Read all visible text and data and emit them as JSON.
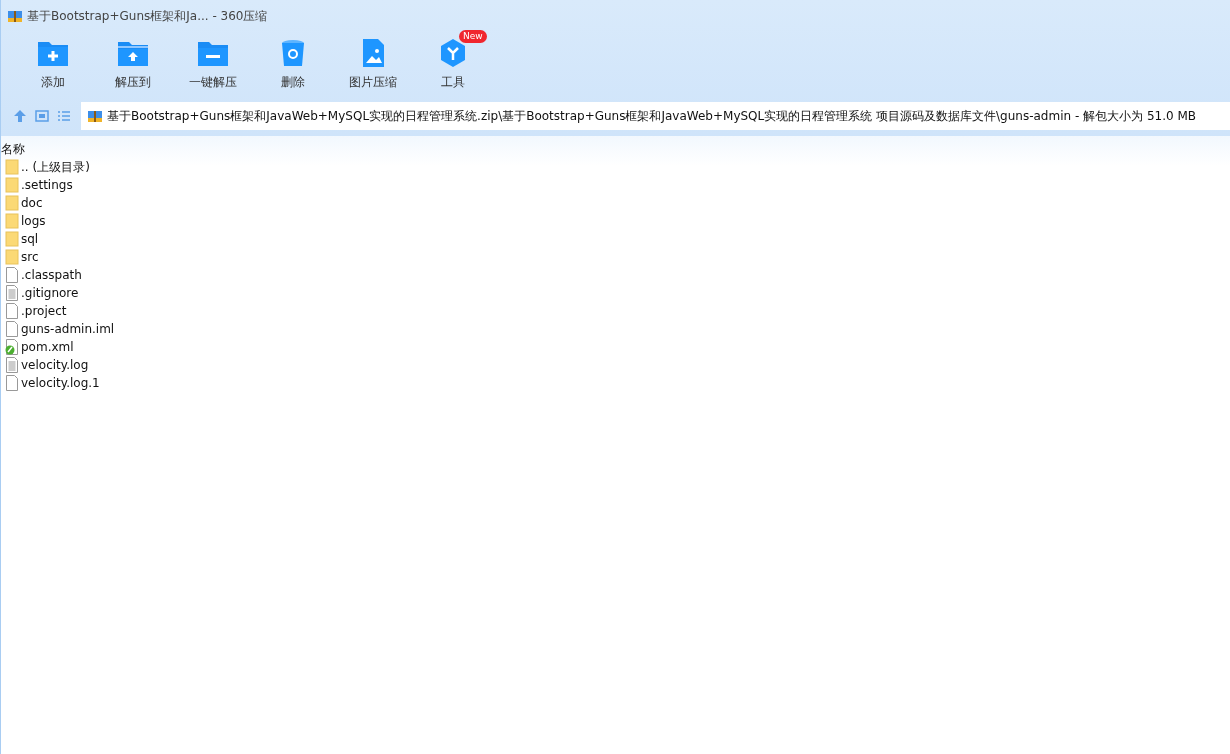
{
  "window": {
    "title": "基于Bootstrap+Guns框架和Ja... - 360压缩"
  },
  "toolbar": [
    {
      "kind": "add",
      "label": "添加"
    },
    {
      "kind": "extract",
      "label": "解压到"
    },
    {
      "kind": "onekey",
      "label": "一键解压"
    },
    {
      "kind": "delete",
      "label": "删除"
    },
    {
      "kind": "image",
      "label": "图片压缩"
    },
    {
      "kind": "tools",
      "label": "工具",
      "badge": "New"
    }
  ],
  "address_bar": {
    "path": "基于Bootstrap+Guns框架和JavaWeb+MySQL实现的日程管理系统.zip\\基于Bootstrap+Guns框架和JavaWeb+MySQL实现的日程管理系统 项目源码及数据库文件\\guns-admin - 解包大小为 51.0 MB"
  },
  "file_list": {
    "columns": [
      "名称"
    ],
    "rows": [
      {
        "kind": "folder",
        "name": ".. (上级目录)"
      },
      {
        "kind": "folder",
        "name": ".settings"
      },
      {
        "kind": "folder",
        "name": "doc"
      },
      {
        "kind": "folder",
        "name": "logs"
      },
      {
        "kind": "folder",
        "name": "sql"
      },
      {
        "kind": "folder",
        "name": "src"
      },
      {
        "kind": "file",
        "name": ".classpath"
      },
      {
        "kind": "text",
        "name": ".gitignore"
      },
      {
        "kind": "file",
        "name": ".project"
      },
      {
        "kind": "file",
        "name": "guns-admin.iml"
      },
      {
        "kind": "xml",
        "name": "pom.xml"
      },
      {
        "kind": "text",
        "name": "velocity.log"
      },
      {
        "kind": "file",
        "name": "velocity.log.1"
      }
    ]
  }
}
